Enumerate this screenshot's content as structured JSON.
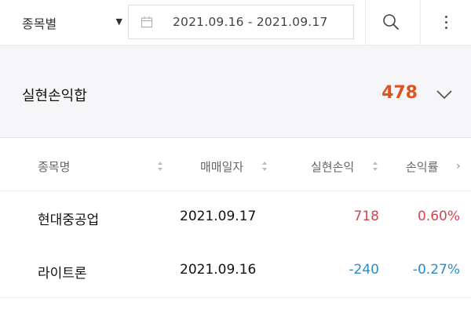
{
  "toolbar": {
    "filter_label": "종목별",
    "date_range": "2021.09.16  -  2021.09.17"
  },
  "summary": {
    "label": "실현손익합",
    "value": "478"
  },
  "table": {
    "headers": [
      "종목명",
      "매매일자",
      "실현손익",
      "손익률"
    ],
    "rows": [
      {
        "name": "현대중공업",
        "date": "2021.09.17",
        "pnl": "718",
        "rate": "0.60%"
      },
      {
        "name": "라이트론",
        "date": "2021.09.16",
        "pnl": "-240",
        "rate": "-0.27%"
      }
    ]
  },
  "colors": {
    "positive": "#d2454f",
    "negative": "#2b8cc4",
    "summary_value": "#e0531f"
  }
}
